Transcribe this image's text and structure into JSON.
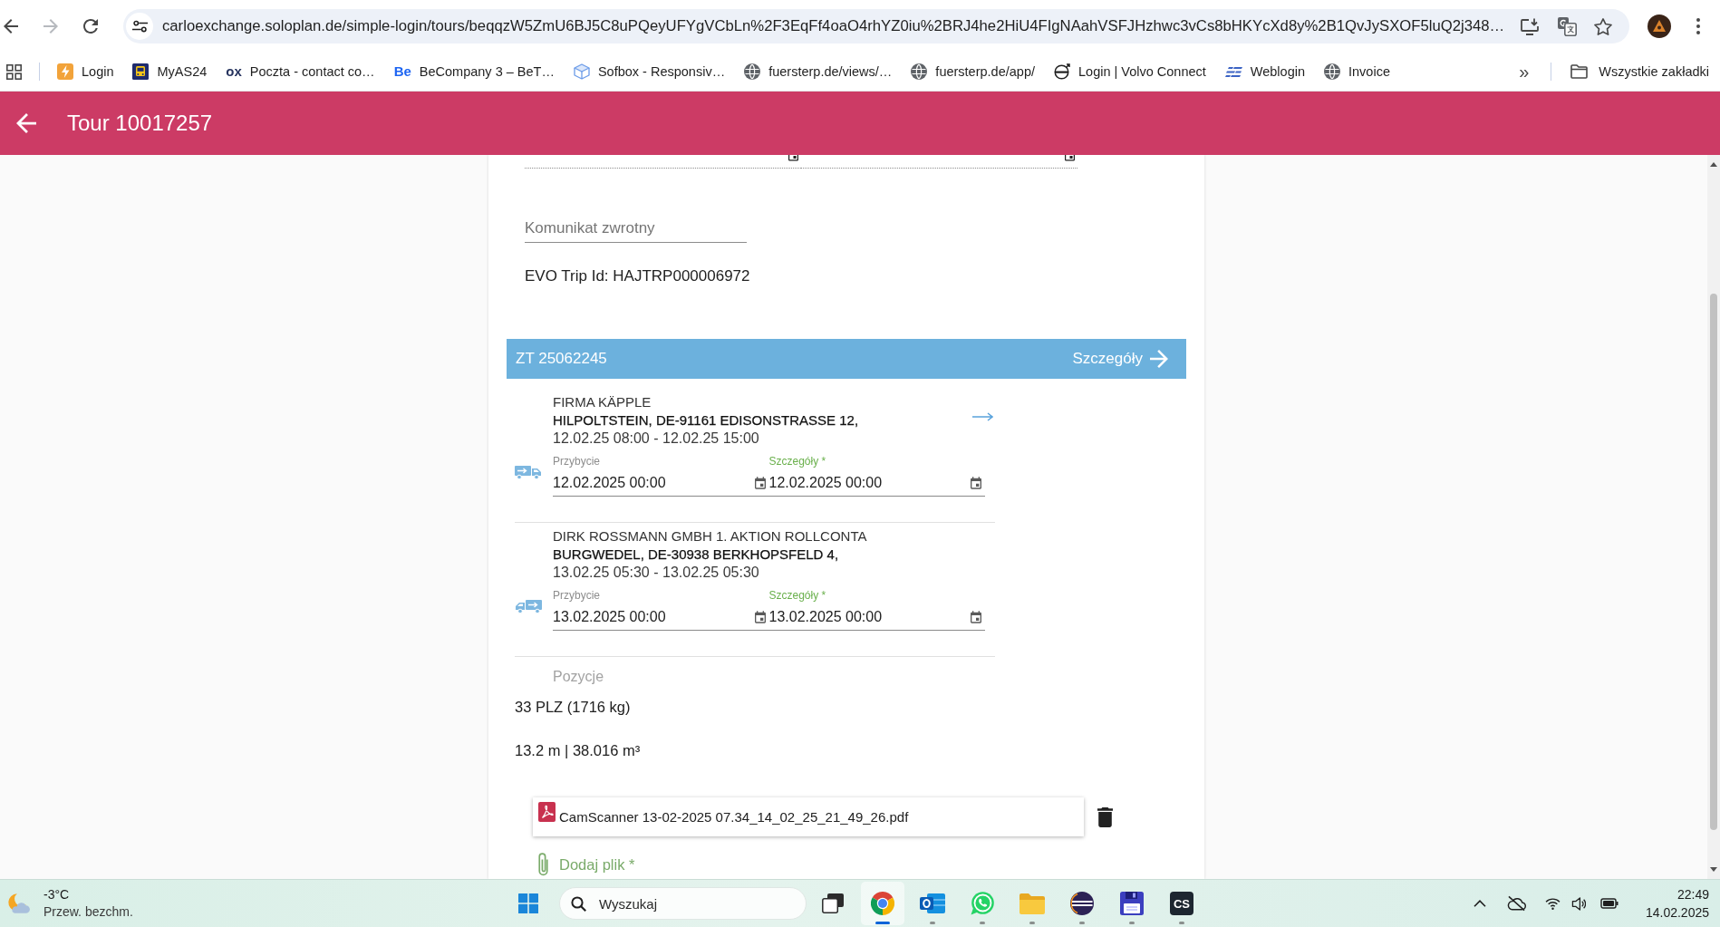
{
  "browser": {
    "nav_buttons": [
      {
        "kind": "back",
        "disabled": false
      },
      {
        "kind": "forward",
        "disabled": true
      },
      {
        "kind": "reload",
        "disabled": false
      }
    ],
    "url": "carloexchange.soloplan.de/simple-login/tours/beqqzW5ZmU6BJ5C8uPQeyUFYgVCbLn%2F3EqFf4oaO4rhYZ0iu%2BRJ4he2HiU4FIgNAahVSFJHzhwc3vCs8bHKYcXd8y%2B1QvJySXOF5luQ2j348…",
    "starred": false,
    "bookmarks": [
      {
        "label": "Login",
        "kind": "bolt"
      },
      {
        "label": "MyAS24",
        "kind": "bus"
      },
      {
        "label": "Poczta - contact co…",
        "kind": "text-logo",
        "logo_text": "ox",
        "color": "#27345f"
      },
      {
        "label": "BeCompany 3 – BeT…",
        "kind": "text-logo",
        "logo_text": "Be",
        "color": "#1c64f2"
      },
      {
        "label": "Sofbox - Responsiv…",
        "kind": "cube"
      },
      {
        "label": "fuersterp.de/views/…",
        "kind": "globe"
      },
      {
        "label": "fuersterp.de/app/",
        "kind": "globe"
      },
      {
        "label": "Login | Volvo Connect",
        "kind": "ring"
      },
      {
        "label": "Weblogin",
        "kind": "stripes"
      },
      {
        "label": "Invoice",
        "kind": "globe"
      }
    ],
    "more_bookmarks": "»",
    "all_bookmarks": "Wszystkie zakładki"
  },
  "header": {
    "title": "Tour 10017257"
  },
  "tour_dates": [
    {
      "disabled": true
    },
    {
      "disabled": true
    }
  ],
  "feedback_field": {
    "placeholder": "Komunikat zwrotny"
  },
  "evo_trip": "EVO Trip Id: HAJTRP000006972",
  "order": {
    "title": "ZT 25062245",
    "details_link": "Szczegóły",
    "stops": [
      {
        "kind": "loading",
        "name": "FIRMA KÄPPLE",
        "address": "HILPOLTSTEIN, DE-91161 EDISONSTRASSE 12,",
        "window": "12.02.25 08:00 - 12.02.25 15:00",
        "route_arrow": true,
        "arrival": {
          "label": "Przybycie",
          "value": "12.02.2025 00:00"
        },
        "departure": {
          "label": "Szczegóły *",
          "value": "12.02.2025 00:00"
        }
      },
      {
        "kind": "unloading",
        "name": "DIRK ROSSMANN GMBH 1. AKTION ROLLCONTA",
        "address": "BURGWEDEL, DE-30938 BERKHOPSFELD 4,",
        "window": "13.02.25 05:30 - 13.02.25 05:30",
        "route_arrow": false,
        "arrival": {
          "label": "Przybycie",
          "value": "13.02.2025 00:00"
        },
        "departure": {
          "label": "Szczegóły *",
          "value": "13.02.2025 00:00"
        }
      }
    ],
    "positions_label": "Pozycje",
    "positions": [
      "33 PLZ (1716 kg)",
      "13.2 m | 38.016 m³"
    ],
    "files": [
      {
        "name": "CamScanner 13-02-2025 07.34_14_02_25_21_49_26.pdf"
      }
    ],
    "add_file": "Dodaj plik *"
  },
  "taskbar": {
    "weather": {
      "temperature": "-3°C",
      "condition": "Przew. bezchm."
    },
    "search": {
      "placeholder": "Wyszukaj"
    },
    "apps": [
      {
        "kind": "task-view",
        "running": false,
        "selected": false
      },
      {
        "kind": "browser",
        "running": true,
        "selected": true
      },
      {
        "kind": "mail",
        "running": true,
        "selected": false
      },
      {
        "kind": "chat",
        "running": true,
        "selected": false
      },
      {
        "kind": "folder",
        "running": true,
        "selected": false
      },
      {
        "kind": "sphere",
        "running": true,
        "selected": false
      },
      {
        "kind": "floppy",
        "running": true,
        "selected": false
      },
      {
        "kind": "text-logo",
        "logo_text": "CS",
        "running": true,
        "selected": false
      }
    ],
    "clock": {
      "time": "22:49",
      "date": "14.02.2025"
    }
  }
}
